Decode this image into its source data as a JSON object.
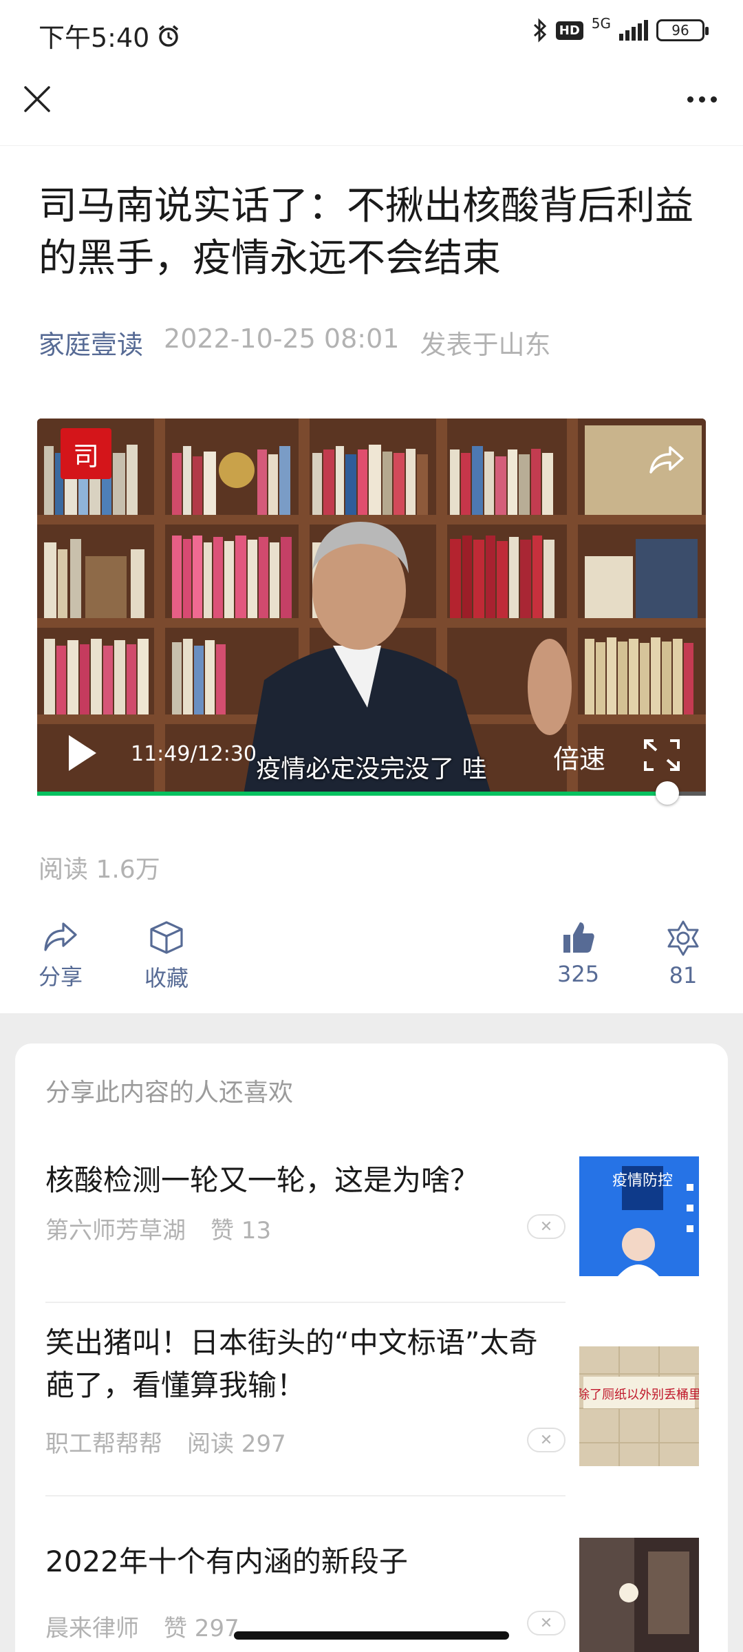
{
  "status_bar": {
    "time": "下午5:40",
    "hd": "HD",
    "network": "5G",
    "battery": "96"
  },
  "nav": {
    "close_icon": "close-icon",
    "more_icon": "more-dots-icon"
  },
  "article": {
    "title": "司马南说实话了：不揪出核酸背后利益的黑手，疫情永远不会结束",
    "author": "家庭壹读",
    "datetime": "2022-10-25 08:01",
    "location": "发表于山东"
  },
  "video": {
    "badge": "司",
    "current_time": "11:49",
    "duration": "12:30",
    "time_display": "11:49/12:30",
    "subtitle": "疫情必定没完没了 哇",
    "speed_label": "倍速",
    "progress_fraction": 0.9427
  },
  "stats": {
    "read_count": "阅读 1.6万",
    "share_label": "分享",
    "favorite_label": "收藏",
    "like_count": "325",
    "wow_count": "81"
  },
  "recommendations": {
    "header": "分享此内容的人还喜欢",
    "items": [
      {
        "title": "核酸检测一轮又一轮，这是为啥？",
        "source": "第六师芳草湖",
        "stat": "赞 13",
        "thumb_text": "疫情防控"
      },
      {
        "title": "笑出猪叫！日本街头的“中文标语”太奇葩了，看懂算我输！",
        "source": "职工帮帮帮",
        "stat": "阅读 297",
        "thumb_text": "除了厕纸以外别丢桶里"
      },
      {
        "title": "2022年十个有内涵的新段子",
        "source": "晨来律师",
        "stat": "赞 297",
        "thumb_text": ""
      }
    ]
  },
  "colors": {
    "link_blue": "#576b95",
    "meta_gray": "#b2b2b2",
    "progress_green": "#07c160",
    "background_gray": "#ededed"
  }
}
